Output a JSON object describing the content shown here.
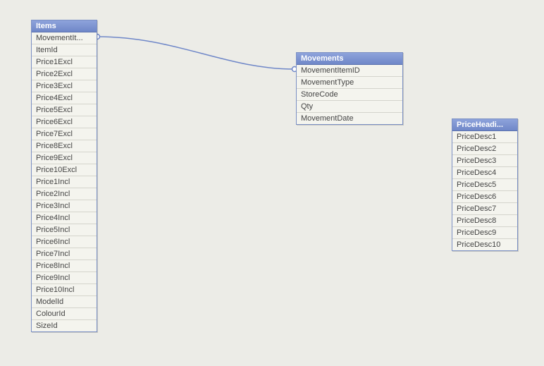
{
  "tables": {
    "items": {
      "title": "Items",
      "fields": [
        "MovementIt...",
        "ItemId",
        "Price1Excl",
        "Price2Excl",
        "Price3Excl",
        "Price4Excl",
        "Price5Excl",
        "Price6Excl",
        "Price7Excl",
        "Price8Excl",
        "Price9Excl",
        "Price10Excl",
        "Price1Incl",
        "Price2Incl",
        "Price3Incl",
        "Price4Incl",
        "Price5Incl",
        "Price6Incl",
        "Price7Incl",
        "Price8Incl",
        "Price9Incl",
        "Price10Incl",
        "ModelId",
        "ColourId",
        "SizeId"
      ]
    },
    "movements": {
      "title": "Movements",
      "fields": [
        "MovementItemID",
        "MovementType",
        "StoreCode",
        "Qty",
        "MovementDate"
      ]
    },
    "priceheadings": {
      "title": "PriceHeadi...",
      "fields": [
        "PriceDesc1",
        "PriceDesc2",
        "PriceDesc3",
        "PriceDesc4",
        "PriceDesc5",
        "PriceDesc6",
        "PriceDesc7",
        "PriceDesc8",
        "PriceDesc9",
        "PriceDesc10"
      ]
    }
  },
  "colors": {
    "header_grad_top": "#8EA3DB",
    "header_grad_bottom": "#6F87C8",
    "border": "#7A8FC4",
    "canvas_bg": "#ECECE7",
    "row_bg": "#F4F4EE",
    "link": "#6F87C8"
  },
  "relationship": {
    "from": "Items.MovementIt...",
    "to": "Movements.MovementItemID"
  }
}
